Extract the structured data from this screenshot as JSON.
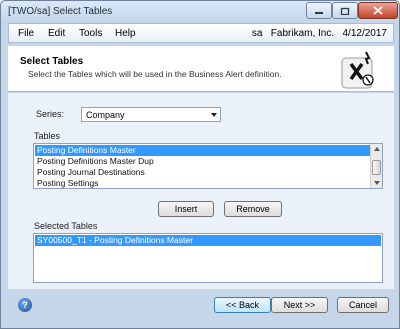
{
  "window": {
    "title": "[TWO/sa]  Select Tables"
  },
  "menu": {
    "items": [
      "File",
      "Edit",
      "Tools",
      "Help"
    ],
    "user": "sa",
    "company": "Fabrikam, Inc.",
    "date": "4/12/2017"
  },
  "header": {
    "title": "Select Tables",
    "subtitle": "Select the Tables which will be used in the Business Alert definition."
  },
  "form": {
    "series_label": "Series:",
    "series_value": "Company",
    "tables_label": "Tables",
    "tables": [
      "Posting Definitions Master",
      "Posting Definitions Master Dup",
      "Posting Journal Destinations",
      "Posting Settings"
    ],
    "tables_selected_index": 0,
    "insert_label": "Insert",
    "remove_label": "Remove",
    "selected_tables_label": "Selected Tables",
    "selected_tables": [
      "SY00500_T1 - Posting Definitions Master"
    ]
  },
  "footer": {
    "help_symbol": "?",
    "back_label": "<< Back",
    "next_label": "Next >>",
    "cancel_label": "Cancel"
  },
  "colors": {
    "selection": "#3399ff",
    "window_frame": "#c5d6e9",
    "body_panel": "#eaf1f9"
  }
}
